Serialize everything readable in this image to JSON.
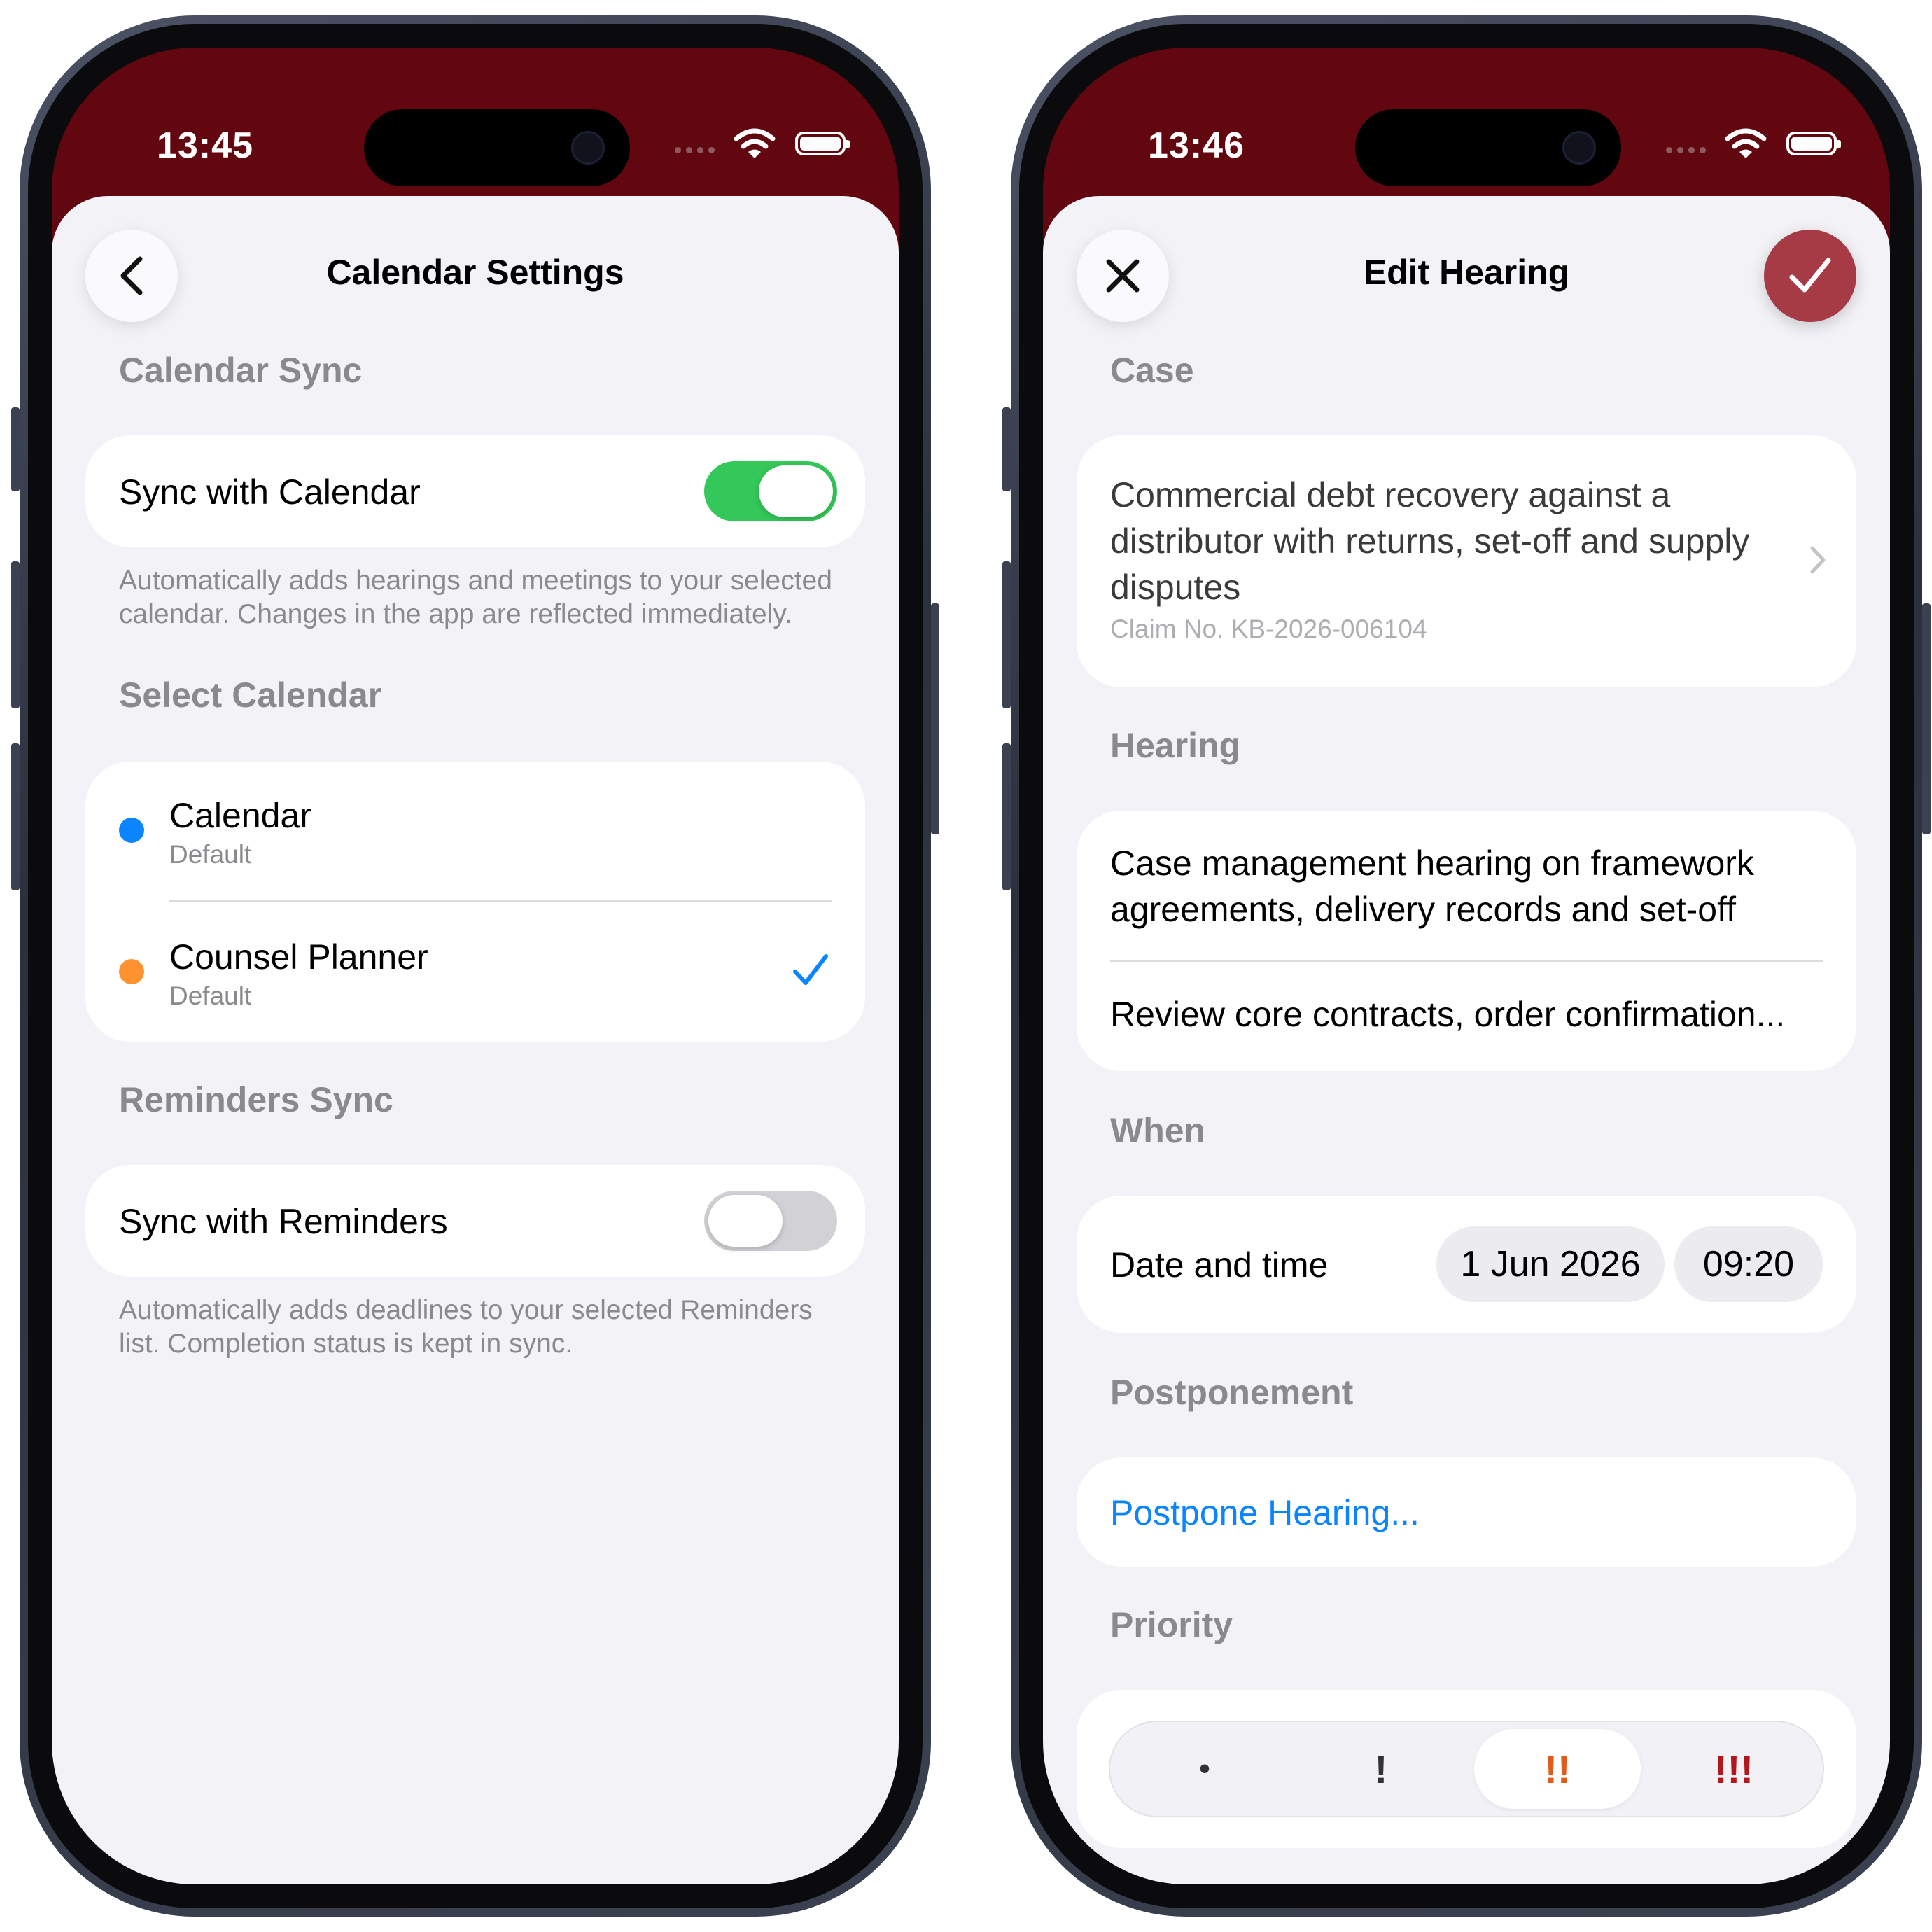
{
  "left_screen": {
    "status_time": "13:45",
    "title": "Calendar Settings",
    "calendar_sync": {
      "section": "Calendar Sync",
      "toggle_label": "Sync with Calendar",
      "enabled": true,
      "footnote": "Automatically adds hearings and meetings to your selected calendar. Changes in the app are reflected immediately."
    },
    "select_calendar": {
      "section": "Select Calendar",
      "items": [
        {
          "name": "Calendar",
          "subtitle": "Default",
          "color": "#0a84ff",
          "selected": false
        },
        {
          "name": "Counsel Planner",
          "subtitle": "Default",
          "color": "#ff9230",
          "selected": true
        }
      ]
    },
    "reminders_sync": {
      "section": "Reminders Sync",
      "toggle_label": "Sync with Reminders",
      "enabled": false,
      "footnote": "Automatically adds deadlines to your selected Reminders list. Completion status is kept in sync."
    }
  },
  "right_screen": {
    "status_time": "13:46",
    "title": "Edit Hearing",
    "case": {
      "section": "Case",
      "title": "Commercial debt recovery against a distributor with returns, set-off and supply disputes",
      "claim": "Claim No. KB-2026-006104"
    },
    "hearing": {
      "section": "Hearing",
      "title": "Case management hearing on framework agreements, delivery records and set-off",
      "notes": "Review core contracts, order confirmation..."
    },
    "when": {
      "section": "When",
      "label": "Date and time",
      "date": "1 Jun 2026",
      "time": "09:20"
    },
    "postponement": {
      "section": "Postponement",
      "action": "Postpone Hearing..."
    },
    "priority": {
      "section": "Priority",
      "options": [
        "•",
        "!",
        "!!",
        "!!!"
      ],
      "selected_index": 2
    }
  },
  "colors": {
    "header": "#62070f",
    "accent": "#a63a45",
    "toggle_on": "#34c759",
    "toggle_off": "#d1d1d6",
    "link": "#0a84ff",
    "priority_medium": "#e25b1a",
    "priority_high": "#b3161d"
  },
  "icons": {
    "back": "chevron-left-icon",
    "close": "close-icon",
    "confirm": "checkmark-icon",
    "selected": "checkmark-icon",
    "disclosure": "chevron-right-icon",
    "wifi": "wifi-icon",
    "battery": "battery-icon"
  }
}
